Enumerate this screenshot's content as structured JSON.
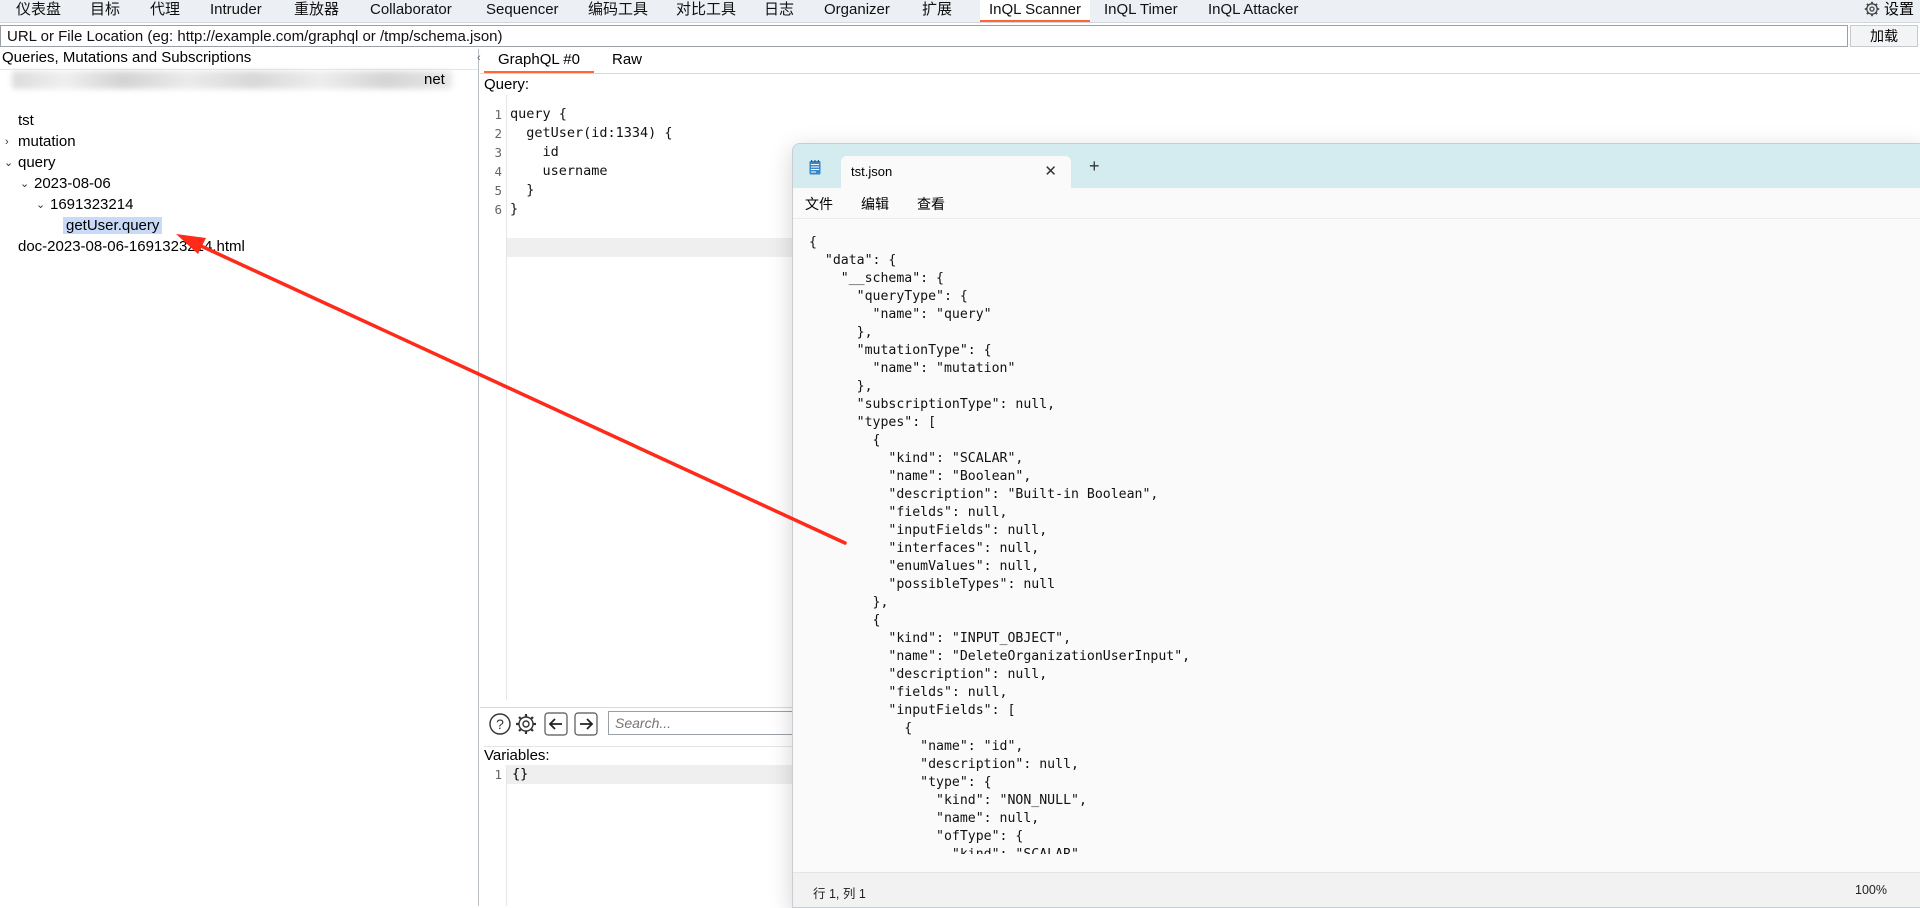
{
  "top_tabs": [
    {
      "label": "仪表盘"
    },
    {
      "label": "目标"
    },
    {
      "label": "代理"
    },
    {
      "label": "Intruder"
    },
    {
      "label": "重放器"
    },
    {
      "label": "Collaborator"
    },
    {
      "label": "Sequencer"
    },
    {
      "label": "编码工具"
    },
    {
      "label": "对比工具"
    },
    {
      "label": "日志"
    },
    {
      "label": "Organizer"
    },
    {
      "label": "扩展"
    },
    {
      "label": "InQL Scanner",
      "active": true
    },
    {
      "label": "InQL Timer"
    },
    {
      "label": "InQL Attacker"
    }
  ],
  "settings_label": "设置",
  "url_bar": {
    "placeholder": "URL or File Location (eg: http://example.com/graphql or /tmp/schema.json)",
    "load_label": "加载"
  },
  "left_panel": {
    "title": "Queries, Mutations and Subscriptions",
    "host_suffix": "net",
    "tree": {
      "tst": "tst",
      "mutation": "mutation",
      "query": "query",
      "date": "2023-08-06",
      "timestamp": "1691323214",
      "selected_query": "getUser.query",
      "doc_file": "doc-2023-08-06-1691323214.html"
    }
  },
  "center": {
    "tabs": [
      "GraphQL #0",
      "Raw"
    ],
    "query_label": "Query:",
    "query_lines": [
      {
        "n": "1",
        "text": "query {"
      },
      {
        "n": "2",
        "text": "  getUser(id:1334) {"
      },
      {
        "n": "3",
        "text": "    id"
      },
      {
        "n": "4",
        "text": "    username"
      },
      {
        "n": "5",
        "text": "  }"
      },
      {
        "n": "6",
        "text": "}"
      }
    ],
    "search_placeholder": "Search...",
    "variables_label": "Variables:",
    "variables_line_number": "1",
    "variables_text": "{}"
  },
  "notepad": {
    "tab_title": "tst.json",
    "menus": [
      "文件",
      "编辑",
      "查看"
    ],
    "status_position": "行 1, 列 1",
    "status_zoom": "100%",
    "content_lines": [
      "{",
      "  \"data\": {",
      "    \"__schema\": {",
      "      \"queryType\": {",
      "        \"name\": \"query\"",
      "      },",
      "      \"mutationType\": {",
      "        \"name\": \"mutation\"",
      "      },",
      "      \"subscriptionType\": null,",
      "      \"types\": [",
      "        {",
      "          \"kind\": \"SCALAR\",",
      "          \"name\": \"Boolean\",",
      "          \"description\": \"Built-in Boolean\",",
      "          \"fields\": null,",
      "          \"inputFields\": null,",
      "          \"interfaces\": null,",
      "          \"enumValues\": null,",
      "          \"possibleTypes\": null",
      "        },",
      "        {",
      "          \"kind\": \"INPUT_OBJECT\",",
      "          \"name\": \"DeleteOrganizationUserInput\",",
      "          \"description\": null,",
      "          \"fields\": null,",
      "          \"inputFields\": [",
      "            {",
      "              \"name\": \"id\",",
      "              \"description\": null,",
      "              \"type\": {",
      "                \"kind\": \"NON_NULL\",",
      "                \"name\": null,",
      "                \"ofType\": {",
      "                  \"kind\": \"SCALAR\","
    ]
  },
  "colors": {
    "active_tab_underline": "#ff6633",
    "arrow": "#ff2a1a",
    "selection": "#c9daf8",
    "notepad_titlebar": "#d4ecf0"
  }
}
